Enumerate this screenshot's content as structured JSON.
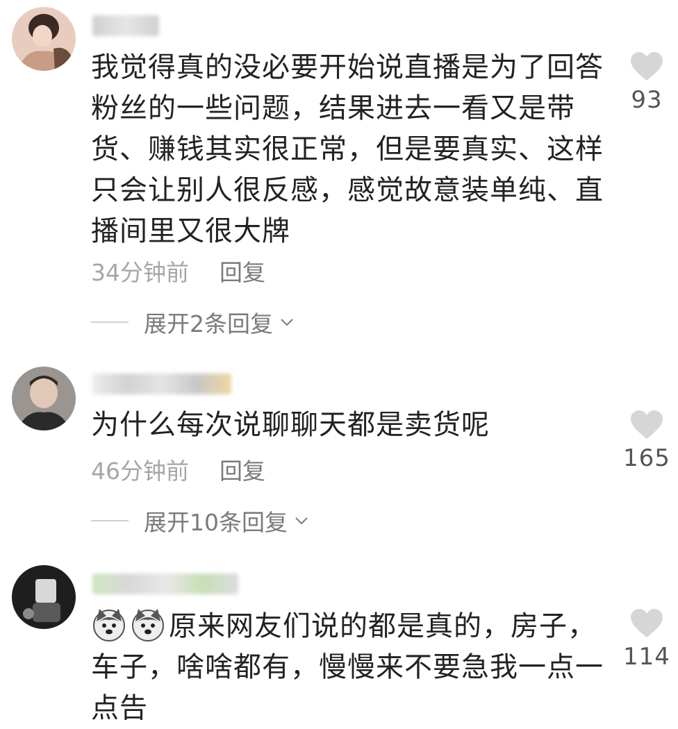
{
  "comments": [
    {
      "text": "我觉得真的没必要开始说直播是为了回答粉丝的一些问题，结果进去一看又是带货、赚钱其实很正常，但是要真实、这样只会让别人很反感，感觉故意装单纯、直播间里又很大牌",
      "time": "34分钟前",
      "reply_label": "回复",
      "likes": "93",
      "expand_label": "展开2条回复"
    },
    {
      "text": "为什么每次说聊聊天都是卖货呢",
      "time": "46分钟前",
      "reply_label": "回复",
      "likes": "165",
      "expand_label": "展开10条回复"
    },
    {
      "text": "原来网友们说的都是真的，房子，车子，啥啥都有，慢慢来不要急我一点一点告",
      "likes": "114",
      "emoji_icons": [
        "husky-emoji-icon",
        "husky-emoji-icon"
      ]
    }
  ],
  "colors": {
    "heart": "#d6d6d6",
    "meta": "#a6a6a6",
    "text": "#222222"
  }
}
